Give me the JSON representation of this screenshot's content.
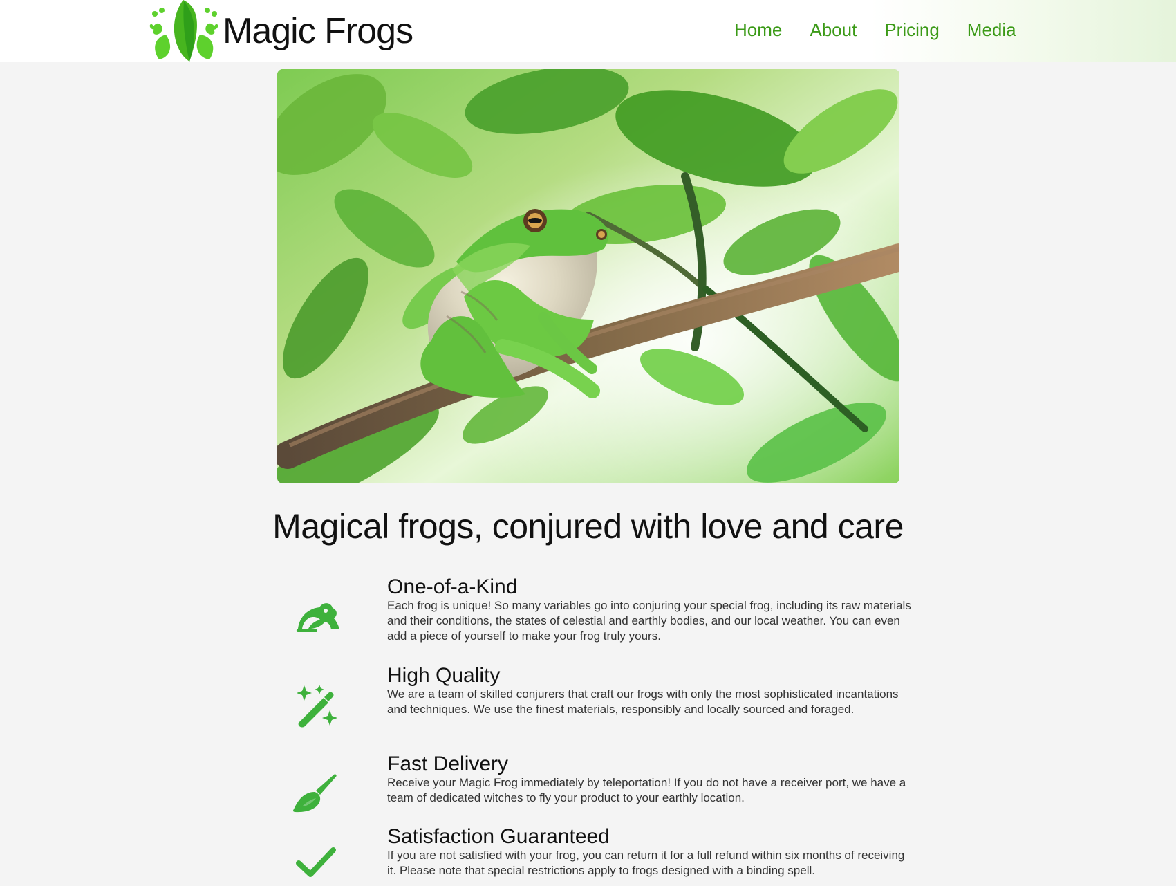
{
  "brand": {
    "name": "Magic Frogs",
    "logo_icon": "frog-leaf-logo-icon",
    "logo_colors": [
      "#4ec51f",
      "#2f9f1a"
    ]
  },
  "nav": {
    "items": [
      {
        "label": "Home"
      },
      {
        "label": "About"
      },
      {
        "label": "Pricing"
      },
      {
        "label": "Media"
      }
    ],
    "link_color": "#3b9a17"
  },
  "hero": {
    "image_subject": "green tree frog on a branch among leaves"
  },
  "headline": "Magical frogs, conjured with love and care",
  "features": [
    {
      "icon": "frog-icon",
      "title": "One-of-a-Kind",
      "text": "Each frog is unique! So many variables go into conjuring your special frog, including its raw materials and their conditions, the states of celestial and earthly bodies, and our local weather. You can even add a piece of yourself to make your frog truly yours."
    },
    {
      "icon": "magic-wand-icon",
      "title": "High Quality",
      "text": "We are a team of skilled conjurers that craft our frogs with only the most sophisticated incantations and techniques. We use the finest materials, responsibly and locally sourced and foraged."
    },
    {
      "icon": "broom-icon",
      "title": "Fast Delivery",
      "text": "Receive your Magic Frog immediately by teleportation! If you do not have a receiver port, we have a team of dedicated witches to fly your product to your earthly location."
    },
    {
      "icon": "check-icon",
      "title": "Satisfaction Guaranteed",
      "text": "If you are not satisfied with your frog, you can return it for a full refund within six months of receiving it. Please note that special restrictions apply to frogs designed with a binding spell."
    }
  ],
  "colors": {
    "accent": "#3eb13c",
    "page_background": "#f4f4f4",
    "text": "#111111"
  }
}
